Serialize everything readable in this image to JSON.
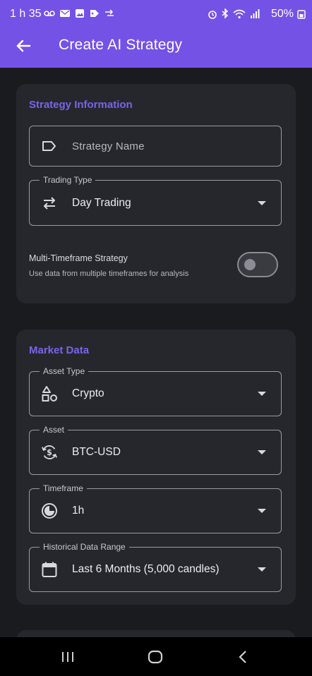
{
  "status_bar": {
    "time": "1 h 35",
    "battery": "50%"
  },
  "app_bar": {
    "title": "Create AI Strategy",
    "back_icon": "arrow-left-icon"
  },
  "strategy_information": {
    "title": "Strategy Information",
    "strategy_name": {
      "placeholder": "Strategy Name",
      "value": "",
      "icon": "label-tag-icon"
    },
    "trading_type": {
      "label": "Trading Type",
      "value": "Day Trading",
      "icon": "swap-horizontal-icon"
    },
    "multi_timeframe": {
      "title": "Multi-Timeframe Strategy",
      "subtitle": "Use data from multiple timeframes for analysis",
      "enabled": false
    }
  },
  "market_data": {
    "title": "Market Data",
    "asset_type": {
      "label": "Asset Type",
      "value": "Crypto",
      "icon": "category-shapes-icon"
    },
    "asset": {
      "label": "Asset",
      "value": "BTC-USD",
      "icon": "currency-exchange-icon"
    },
    "timeframe": {
      "label": "Timeframe",
      "value": "1h",
      "icon": "clock-pie-icon"
    },
    "historical_range": {
      "label": "Historical Data Range",
      "value": "Last 6 Months (5,000 candles)",
      "icon": "calendar-icon"
    }
  },
  "colors": {
    "accent": "#7452e6",
    "section_title": "#7b63ea",
    "card": "#26272c",
    "background": "#1a1b1f"
  },
  "nav_bar": {
    "recents_icon": "recents-icon",
    "home_icon": "home-icon",
    "back_icon": "back-chevron-icon"
  }
}
